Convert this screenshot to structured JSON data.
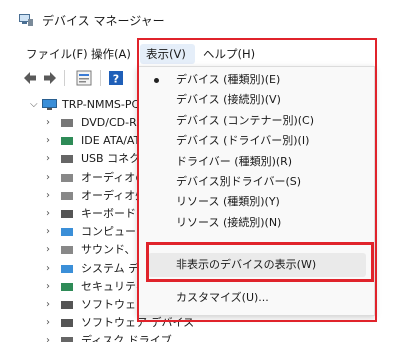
{
  "window": {
    "title": "デバイス マネージャー",
    "title_icon": "device-manager-icon"
  },
  "menubar": {
    "file": "ファイル(F)",
    "action": "操作(A)",
    "view": "表示(V)",
    "help": "ヘルプ(H)"
  },
  "toolbar": {
    "icons": [
      "back-arrow-icon",
      "forward-arrow-icon",
      "properties-icon",
      "help-icon"
    ]
  },
  "tree": {
    "root": {
      "label": "TRP-NMMS-PC",
      "icon": "computer-icon"
    },
    "devices": [
      {
        "label": "DVD/CD-RO",
        "icon": "dvd-drive-icon"
      },
      {
        "label": "IDE ATA/AT",
        "icon": "ide-controller-icon"
      },
      {
        "label": "USB コネクタ",
        "icon": "usb-connector-icon"
      },
      {
        "label": "オーディオの",
        "icon": "audio-io-icon"
      },
      {
        "label": "オーディオ処",
        "icon": "audio-processing-icon"
      },
      {
        "label": "キーボード",
        "icon": "keyboard-icon"
      },
      {
        "label": "コンピューター",
        "icon": "computer-icon"
      },
      {
        "label": "サウンド、ビデ",
        "icon": "sound-video-icon"
      },
      {
        "label": "システム デバ",
        "icon": "system-device-icon"
      },
      {
        "label": "セキュリティ",
        "icon": "security-device-icon"
      },
      {
        "label": "ソフトウェア コ",
        "icon": "software-component-icon"
      },
      {
        "label": "ソフトウェア デバイス",
        "icon": "software-device-icon"
      },
      {
        "label": "ディスク ドライブ",
        "icon": "disk-drive-icon"
      }
    ]
  },
  "view_menu": {
    "items": [
      {
        "label": "デバイス (種類別)(E)",
        "checked": true
      },
      {
        "label": "デバイス (接続別)(V)",
        "checked": false
      },
      {
        "label": "デバイス (コンテナー別)(C)",
        "checked": false
      },
      {
        "label": "デバイス (ドライバー別)(I)",
        "checked": false
      },
      {
        "label": "ドライバー (種類別)(R)",
        "checked": false
      },
      {
        "label": "デバイス別ドライバー(S)",
        "checked": false
      },
      {
        "label": "リソース (種類別)(Y)",
        "checked": false
      },
      {
        "label": "リソース (接続別)(N)",
        "checked": false
      }
    ],
    "show_hidden": "非表示のデバイスの表示(W)",
    "customize": "カスタマイズ(U)..."
  },
  "colors": {
    "highlight_box": "#e0232b",
    "menu_active": "#e5eef9"
  }
}
